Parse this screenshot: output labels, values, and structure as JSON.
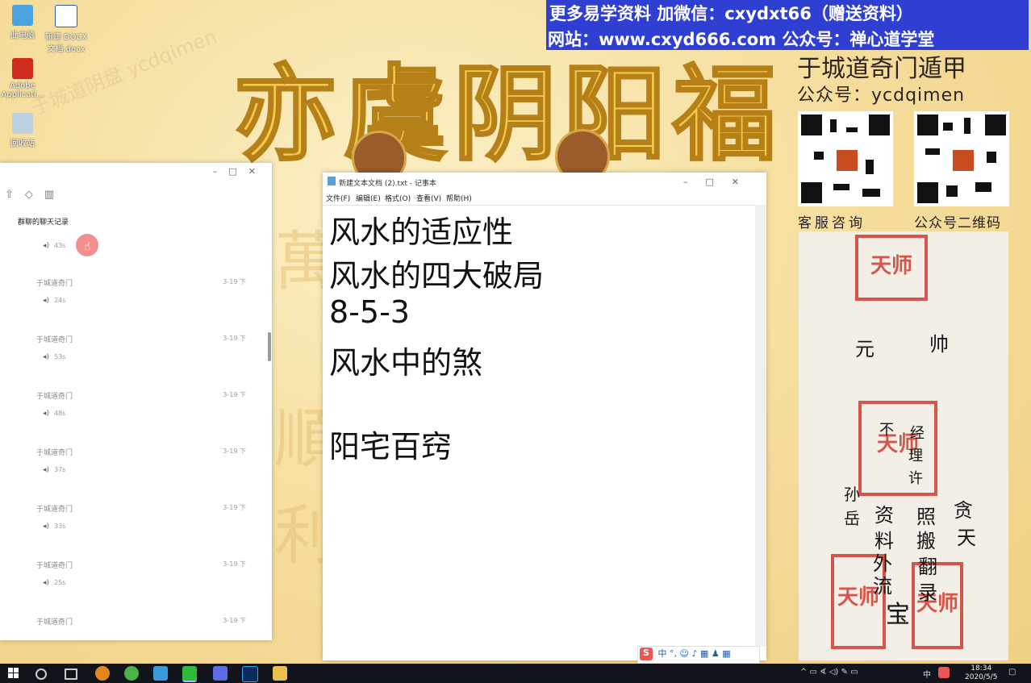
{
  "desktop": {
    "icons": [
      {
        "label": "此电脑"
      },
      {
        "label": "新建 DOCX 文档.docx"
      },
      {
        "label": "Adobe Applicati..."
      },
      {
        "label": "回收站"
      }
    ],
    "background_title": "亦虞阴阳福",
    "watermark": "于城道阴盘 ycdqimen"
  },
  "banner": {
    "line1": "更多易学资料   加微信：cxydxt66（赠送资料）",
    "line2": "网站：www.cxyd666.com 公众号：禅心道学堂",
    "bg_color": "#2f3fd2"
  },
  "brand": {
    "title": "于城道奇门遁甲",
    "subtitle": "公众号：ycdqimen",
    "qr_left_caption": "客服咨询",
    "qr_right_caption": "公众号二维码"
  },
  "charm": {
    "seal_text": "天师",
    "ink_lines": [
      "元",
      "帅",
      "不",
      "经",
      "理",
      "许",
      "贪",
      "天",
      "资",
      "照",
      "搬",
      "翻",
      "录",
      "料",
      "外",
      "流",
      "孙",
      "岳",
      "宝"
    ]
  },
  "chat_window": {
    "title": "群聊的聊天记录",
    "first_duration": "43s",
    "messages": [
      {
        "sender": "于城道奇门",
        "date": "3-19 下",
        "duration": "24s"
      },
      {
        "sender": "于城道奇门",
        "date": "3-19 下",
        "duration": "53s"
      },
      {
        "sender": "于城道奇门",
        "date": "3-19 下",
        "duration": "48s"
      },
      {
        "sender": "于城道奇门",
        "date": "3-19 下",
        "duration": "37s"
      },
      {
        "sender": "于城道奇门",
        "date": "3-19 下",
        "duration": "33s"
      },
      {
        "sender": "于城道奇门",
        "date": "3-19 下",
        "duration": "25s"
      },
      {
        "sender": "于城道奇门",
        "date": "3-19 下",
        "duration": ""
      }
    ]
  },
  "notepad": {
    "title": "新建文本文档 (2).txt - 记事本",
    "menu": [
      "文件(F)",
      "编辑(E)",
      "格式(O)",
      "查看(V)",
      "帮助(H)"
    ],
    "lines": [
      "风水的适应性",
      "风水的四大破局",
      "8-5-3",
      "风水中的煞",
      "",
      "阳宅百窍"
    ]
  },
  "ime": {
    "mode": "中"
  },
  "taskbar": {
    "time": "18:34",
    "date": "2020/5/5",
    "lang": "中"
  }
}
